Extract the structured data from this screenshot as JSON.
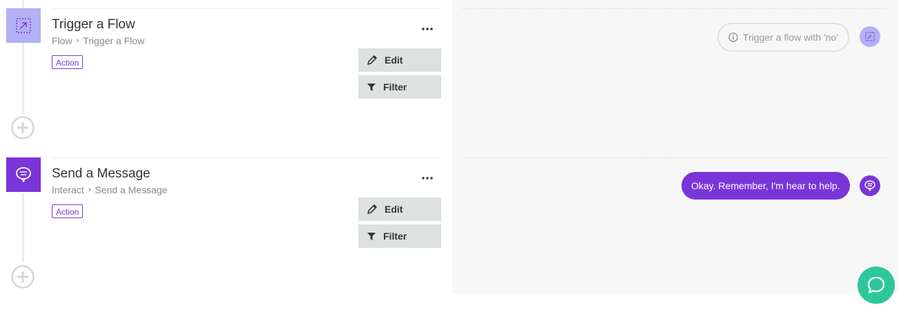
{
  "steps": [
    {
      "title": "Trigger a Flow",
      "crumb_parent": "Flow",
      "crumb_child": "Trigger a Flow",
      "badge": "Action",
      "more": "...",
      "edit_label": "Edit",
      "filter_label": "Filter",
      "icon": "trigger-flow-icon"
    },
    {
      "title": "Send a Message",
      "crumb_parent": "Interact",
      "crumb_child": "Send a Message",
      "badge": "Action",
      "more": "...",
      "edit_label": "Edit",
      "filter_label": "Filter",
      "icon": "chat-bubble-icon"
    }
  ],
  "preview": {
    "trigger_text": "Trigger a flow with 'no'",
    "message_text": "Okay. Remember, I'm hear to help."
  },
  "colors": {
    "accent": "#7a35d9",
    "trigger_icon_bg": "#b3b0f5",
    "button_bg": "#dde1e0",
    "preview_bg": "#f7f7f7",
    "chat_fab": "#2ec79a"
  }
}
